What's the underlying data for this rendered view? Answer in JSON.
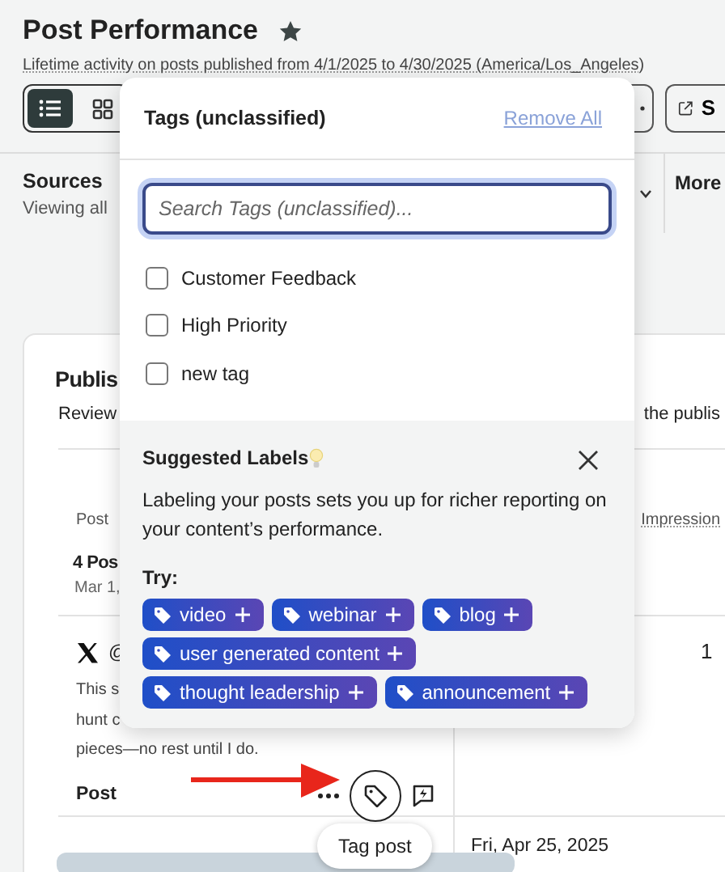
{
  "header": {
    "title": "Post Performance",
    "starred": true,
    "subtitle": "Lifetime activity on posts published from 4/1/2025 to 4/30/2025 (America/Los_Angeles)"
  },
  "view_toggle": [
    {
      "kind": "list",
      "selected": true
    },
    {
      "kind": "grid",
      "selected": false
    }
  ],
  "share_button": {
    "label": "S"
  },
  "filters": [
    {
      "label": "Sources",
      "value": "Viewing all"
    },
    {
      "label": "More"
    }
  ],
  "card": {
    "title": "Publis",
    "description": "Review",
    "description_end": "the publis",
    "columns": [
      "Post",
      "Impression"
    ],
    "rows": [
      {
        "kind": "summary",
        "title": "4 Pos",
        "date": "Mar 1,"
      },
      {
        "kind": "post",
        "handle": "@",
        "lines": [
          "This s",
          "hunt c",
          "pieces—no rest until I do."
        ],
        "type": "Post",
        "value": "1"
      },
      {
        "kind": "next",
        "date": "Fri, Apr 25, 2025"
      }
    ]
  },
  "tooltip": "Tag post",
  "popover": {
    "title": "Tags (unclassified)",
    "remove_all": "Remove All",
    "search_placeholder": "Search Tags (unclassified)...",
    "tags": [
      {
        "label": "Customer Feedback",
        "checked": false
      },
      {
        "label": "High Priority",
        "checked": false
      },
      {
        "label": "new tag",
        "checked": false
      }
    ],
    "suggestions": {
      "title": "Suggested Labels",
      "text": "Labeling your posts sets you up for richer reporting on your content’s performance.",
      "try_label": "Try:",
      "chips": [
        [
          "video",
          "webinar",
          "blog"
        ],
        [
          "user generated content"
        ],
        [
          "thought leadership",
          "announcement"
        ]
      ]
    }
  }
}
